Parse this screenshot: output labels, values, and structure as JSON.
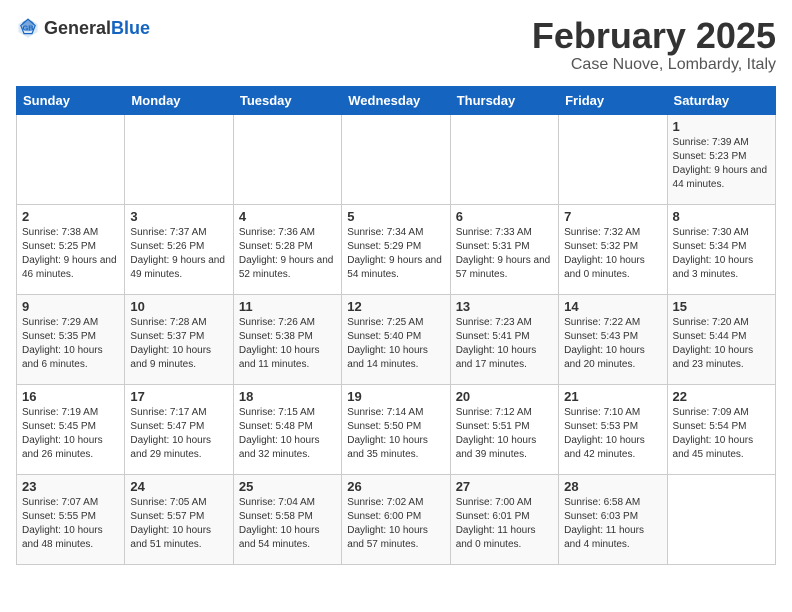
{
  "header": {
    "logo_general": "General",
    "logo_blue": "Blue",
    "title": "February 2025",
    "subtitle": "Case Nuove, Lombardy, Italy"
  },
  "days_of_week": [
    "Sunday",
    "Monday",
    "Tuesday",
    "Wednesday",
    "Thursday",
    "Friday",
    "Saturday"
  ],
  "weeks": [
    [
      null,
      null,
      null,
      null,
      null,
      null,
      {
        "day": "1",
        "sunrise": "7:39 AM",
        "sunset": "5:23 PM",
        "daylight": "9 hours and 44 minutes."
      }
    ],
    [
      {
        "day": "2",
        "sunrise": "7:38 AM",
        "sunset": "5:25 PM",
        "daylight": "9 hours and 46 minutes."
      },
      {
        "day": "3",
        "sunrise": "7:37 AM",
        "sunset": "5:26 PM",
        "daylight": "9 hours and 49 minutes."
      },
      {
        "day": "4",
        "sunrise": "7:36 AM",
        "sunset": "5:28 PM",
        "daylight": "9 hours and 52 minutes."
      },
      {
        "day": "5",
        "sunrise": "7:34 AM",
        "sunset": "5:29 PM",
        "daylight": "9 hours and 54 minutes."
      },
      {
        "day": "6",
        "sunrise": "7:33 AM",
        "sunset": "5:31 PM",
        "daylight": "9 hours and 57 minutes."
      },
      {
        "day": "7",
        "sunrise": "7:32 AM",
        "sunset": "5:32 PM",
        "daylight": "10 hours and 0 minutes."
      },
      {
        "day": "8",
        "sunrise": "7:30 AM",
        "sunset": "5:34 PM",
        "daylight": "10 hours and 3 minutes."
      }
    ],
    [
      {
        "day": "9",
        "sunrise": "7:29 AM",
        "sunset": "5:35 PM",
        "daylight": "10 hours and 6 minutes."
      },
      {
        "day": "10",
        "sunrise": "7:28 AM",
        "sunset": "5:37 PM",
        "daylight": "10 hours and 9 minutes."
      },
      {
        "day": "11",
        "sunrise": "7:26 AM",
        "sunset": "5:38 PM",
        "daylight": "10 hours and 11 minutes."
      },
      {
        "day": "12",
        "sunrise": "7:25 AM",
        "sunset": "5:40 PM",
        "daylight": "10 hours and 14 minutes."
      },
      {
        "day": "13",
        "sunrise": "7:23 AM",
        "sunset": "5:41 PM",
        "daylight": "10 hours and 17 minutes."
      },
      {
        "day": "14",
        "sunrise": "7:22 AM",
        "sunset": "5:43 PM",
        "daylight": "10 hours and 20 minutes."
      },
      {
        "day": "15",
        "sunrise": "7:20 AM",
        "sunset": "5:44 PM",
        "daylight": "10 hours and 23 minutes."
      }
    ],
    [
      {
        "day": "16",
        "sunrise": "7:19 AM",
        "sunset": "5:45 PM",
        "daylight": "10 hours and 26 minutes."
      },
      {
        "day": "17",
        "sunrise": "7:17 AM",
        "sunset": "5:47 PM",
        "daylight": "10 hours and 29 minutes."
      },
      {
        "day": "18",
        "sunrise": "7:15 AM",
        "sunset": "5:48 PM",
        "daylight": "10 hours and 32 minutes."
      },
      {
        "day": "19",
        "sunrise": "7:14 AM",
        "sunset": "5:50 PM",
        "daylight": "10 hours and 35 minutes."
      },
      {
        "day": "20",
        "sunrise": "7:12 AM",
        "sunset": "5:51 PM",
        "daylight": "10 hours and 39 minutes."
      },
      {
        "day": "21",
        "sunrise": "7:10 AM",
        "sunset": "5:53 PM",
        "daylight": "10 hours and 42 minutes."
      },
      {
        "day": "22",
        "sunrise": "7:09 AM",
        "sunset": "5:54 PM",
        "daylight": "10 hours and 45 minutes."
      }
    ],
    [
      {
        "day": "23",
        "sunrise": "7:07 AM",
        "sunset": "5:55 PM",
        "daylight": "10 hours and 48 minutes."
      },
      {
        "day": "24",
        "sunrise": "7:05 AM",
        "sunset": "5:57 PM",
        "daylight": "10 hours and 51 minutes."
      },
      {
        "day": "25",
        "sunrise": "7:04 AM",
        "sunset": "5:58 PM",
        "daylight": "10 hours and 54 minutes."
      },
      {
        "day": "26",
        "sunrise": "7:02 AM",
        "sunset": "6:00 PM",
        "daylight": "10 hours and 57 minutes."
      },
      {
        "day": "27",
        "sunrise": "7:00 AM",
        "sunset": "6:01 PM",
        "daylight": "11 hours and 0 minutes."
      },
      {
        "day": "28",
        "sunrise": "6:58 AM",
        "sunset": "6:03 PM",
        "daylight": "11 hours and 4 minutes."
      },
      null
    ]
  ]
}
